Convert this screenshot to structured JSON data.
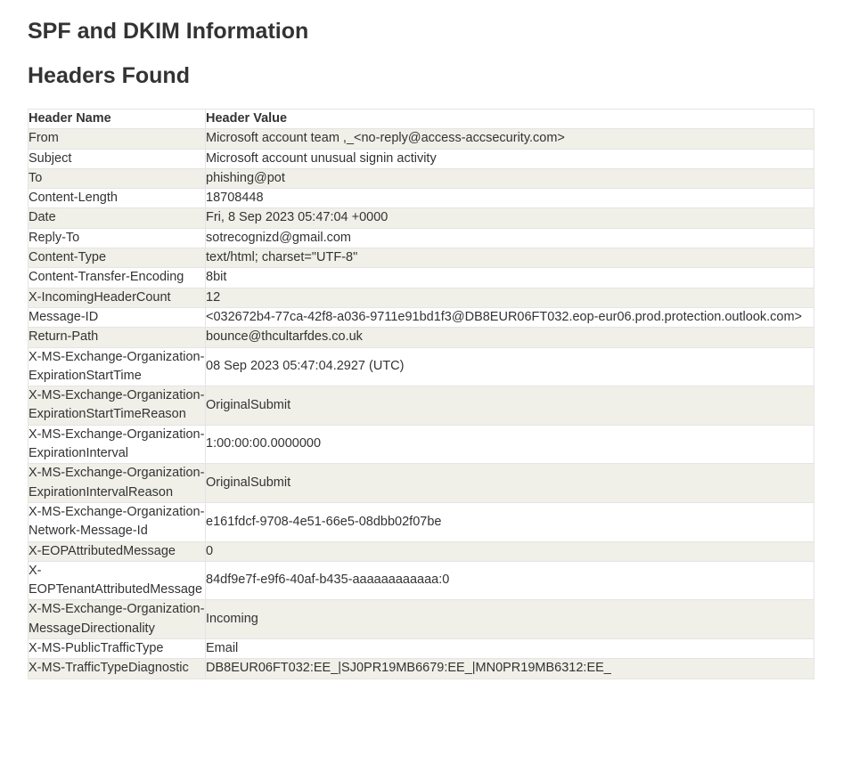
{
  "page": {
    "title": "SPF and DKIM Information",
    "section_title": "Headers Found"
  },
  "table": {
    "columns": [
      "Header Name",
      "Header Value"
    ],
    "rows": [
      {
        "name": "From",
        "value": "Microsoft account team ,_<no-reply@access-accsecurity.com>"
      },
      {
        "name": "Subject",
        "value": "Microsoft account unusual signin activity"
      },
      {
        "name": "To",
        "value": "phishing@pot"
      },
      {
        "name": "Content-Length",
        "value": "18708448"
      },
      {
        "name": "Date",
        "value": "Fri, 8 Sep 2023 05:47:04 +0000"
      },
      {
        "name": "Reply-To",
        "value": "sotrecognizd@gmail.com"
      },
      {
        "name": "Content-Type",
        "value": "text/html; charset=\"UTF-8\""
      },
      {
        "name": "Content-Transfer-Encoding",
        "value": "8bit"
      },
      {
        "name": "X-IncomingHeaderCount",
        "value": "12"
      },
      {
        "name": "Message-ID",
        "value": "<032672b4-77ca-42f8-a036-9711e91bd1f3@DB8EUR06FT032.eop-eur06.prod.protection.outlook.com>"
      },
      {
        "name": "Return-Path",
        "value": "bounce@thcultarfdes.co.uk"
      },
      {
        "name": "X-MS-Exchange-Organization-ExpirationStartTime",
        "value": "08 Sep 2023 05:47:04.2927 (UTC)"
      },
      {
        "name": "X-MS-Exchange-Organization-ExpirationStartTimeReason",
        "value": "OriginalSubmit"
      },
      {
        "name": "X-MS-Exchange-Organization-ExpirationInterval",
        "value": "1:00:00:00.0000000"
      },
      {
        "name": "X-MS-Exchange-Organization-ExpirationIntervalReason",
        "value": "OriginalSubmit"
      },
      {
        "name": "X-MS-Exchange-Organization-Network-Message-Id",
        "value": "e161fdcf-9708-4e51-66e5-08dbb02f07be"
      },
      {
        "name": "X-EOPAttributedMessage",
        "value": "0"
      },
      {
        "name": "X-EOPTenantAttributedMessage",
        "value": "84df9e7f-e9f6-40af-b435-aaaaaaaaaaaa:0"
      },
      {
        "name": "X-MS-Exchange-Organization-MessageDirectionality",
        "value": "Incoming"
      },
      {
        "name": "X-MS-PublicTrafficType",
        "value": "Email"
      },
      {
        "name": "X-MS-TrafficTypeDiagnostic",
        "value": "DB8EUR06FT032:EE_|SJ0PR19MB6679:EE_|MN0PR19MB6312:EE_"
      }
    ]
  }
}
